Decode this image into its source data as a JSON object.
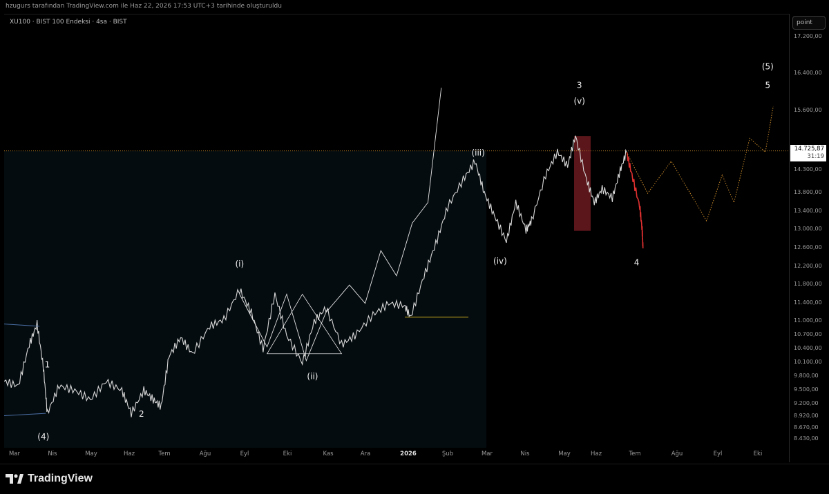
{
  "header": {
    "created_by": "hzugurs tarafından TradingView.com ile Haz 22, 2026 17:53 UTC+3 tarihinde oluşturuldu"
  },
  "symbol_label": "XU100 · BIST 100 Endeksi · 4sa · BIST",
  "scale_button": "point",
  "footer": {
    "brand": "TradingView"
  },
  "colors": {
    "background": "#000000",
    "text": "#cfcfcf",
    "candle": "#d9d9d9",
    "projection": "#c98a2a",
    "decline": "#e03030",
    "highlight_box": "#6a1a1f",
    "baseline": "#d2b11f",
    "green_label": "#35b34a"
  },
  "last_price": {
    "value": "14.725,87",
    "timer": "31:19"
  },
  "chart_data": {
    "type": "line",
    "title": "",
    "xlabel": "",
    "ylabel": "",
    "ylim": [
      8250,
      17700
    ],
    "price_ticks": [
      "17.200,00",
      "16.400,00",
      "15.600,00",
      "14.300,00",
      "13.800,00",
      "13.400,00",
      "13.000,00",
      "12.600,00",
      "12.200,00",
      "11.800,00",
      "11.400,00",
      "11.000,00",
      "10.700,00",
      "10.400,00",
      "10.100,00",
      "9.800,00",
      "9.500,00",
      "9.200,00",
      "8.920,00",
      "8.670,00",
      "8.430,00"
    ],
    "time_ticks": [
      "Mar",
      "Nis",
      "May",
      "Haz",
      "Tem",
      "Ağu",
      "Eyl",
      "Eki",
      "Kas",
      "Ara",
      "2026",
      "Şub",
      "Mar",
      "Nis",
      "May",
      "Haz",
      "Tem",
      "Ağu",
      "Eyl",
      "Eki"
    ],
    "grid": false,
    "series": [
      {
        "values": [
          [
            0,
            9700
          ],
          [
            0.018,
            9600
          ],
          [
            0.032,
            10500
          ],
          [
            0.042,
            10950
          ],
          [
            0.05,
            10000
          ],
          [
            0.055,
            9000
          ],
          [
            0.07,
            9600
          ],
          [
            0.09,
            9500
          ],
          [
            0.11,
            9300
          ],
          [
            0.13,
            9700
          ],
          [
            0.15,
            9500
          ],
          [
            0.162,
            9000
          ],
          [
            0.178,
            9500
          ],
          [
            0.19,
            9300
          ],
          [
            0.2,
            9150
          ],
          [
            0.21,
            10250
          ],
          [
            0.225,
            10650
          ],
          [
            0.24,
            10300
          ],
          [
            0.262,
            10900
          ],
          [
            0.28,
            11050
          ],
          [
            0.3,
            11700
          ],
          [
            0.315,
            11200
          ],
          [
            0.33,
            10400
          ],
          [
            0.345,
            11600
          ],
          [
            0.36,
            10700
          ],
          [
            0.38,
            10100
          ],
          [
            0.395,
            11000
          ],
          [
            0.41,
            11300
          ],
          [
            0.43,
            10500
          ],
          [
            0.447,
            10700
          ],
          [
            0.47,
            11150
          ],
          [
            0.49,
            11400
          ],
          [
            0.51,
            11350
          ],
          [
            0.518,
            11100
          ],
          [
            0.535,
            12000
          ],
          [
            0.55,
            12700
          ],
          [
            0.565,
            13500
          ],
          [
            0.585,
            14100
          ],
          [
            0.6,
            14500
          ],
          [
            0.612,
            13800
          ],
          [
            0.625,
            13300
          ],
          [
            0.64,
            12750
          ],
          [
            0.652,
            13600
          ],
          [
            0.665,
            13000
          ],
          [
            0.672,
            13200
          ],
          [
            0.69,
            14200
          ],
          [
            0.705,
            14700
          ],
          [
            0.718,
            14400
          ],
          [
            0.728,
            15050
          ],
          [
            0.742,
            14100
          ],
          [
            0.752,
            13600
          ],
          [
            0.762,
            13900
          ],
          [
            0.775,
            13700
          ],
          [
            0.785,
            14300
          ],
          [
            0.793,
            14700
          ]
        ]
      },
      {
        "values": [
          [
            0.793,
            14700
          ],
          [
            0.8,
            14200
          ],
          [
            0.81,
            13500
          ],
          [
            0.813,
            13000
          ],
          [
            0.814,
            12600
          ]
        ]
      },
      {
        "values": [
          [
            0.793,
            14700
          ],
          [
            0.82,
            13800
          ],
          [
            0.85,
            14500
          ],
          [
            0.895,
            13200
          ],
          [
            0.915,
            14200
          ],
          [
            0.93,
            13600
          ],
          [
            0.95,
            15000
          ],
          [
            0.97,
            14700
          ],
          [
            0.98,
            15700
          ]
        ]
      }
    ],
    "waves": [
      {
        "label": "(4)",
        "x": 0.05,
        "y": 8430
      },
      {
        "label": "1",
        "x": 0.055,
        "y": 10000
      },
      {
        "label": "2",
        "x": 0.175,
        "y": 8930
      },
      {
        "label": "(i)",
        "x": 0.3,
        "y": 12200
      },
      {
        "label": "(ii)",
        "x": 0.393,
        "y": 9750
      },
      {
        "label": "(iii)",
        "x": 0.604,
        "y": 14620
      },
      {
        "label": "(iv)",
        "x": 0.632,
        "y": 12260
      },
      {
        "label": "3",
        "x": 0.733,
        "y": 16100
      },
      {
        "label": "(v)",
        "x": 0.733,
        "y": 15750
      },
      {
        "label": "4",
        "x": 0.806,
        "y": 12230
      },
      {
        "label": "(5)",
        "x": 0.973,
        "y": 16500
      },
      {
        "label": "5",
        "x": 0.973,
        "y": 16100
      }
    ]
  }
}
